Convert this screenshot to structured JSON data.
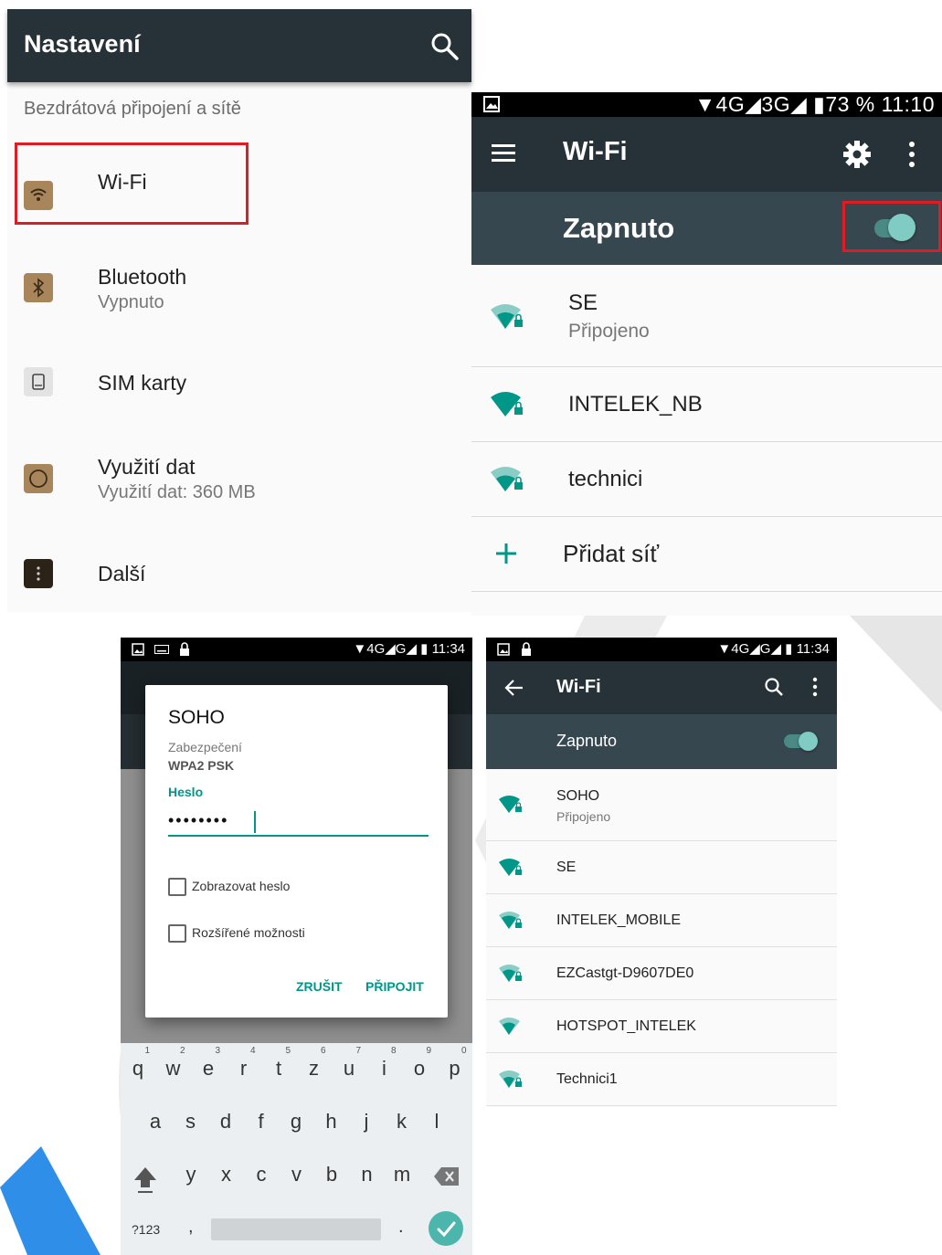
{
  "settings": {
    "title": "Nastavení",
    "section": "Bezdrátová připojení a sítě",
    "items": [
      {
        "label": "Wi-Fi",
        "sub": ""
      },
      {
        "label": "Bluetooth",
        "sub": "Vypnuto"
      },
      {
        "label": "SIM karty",
        "sub": ""
      },
      {
        "label": "Využití dat",
        "sub": "Využití dat: 360 MB"
      },
      {
        "label": "Další",
        "sub": ""
      }
    ]
  },
  "wifi1": {
    "status": "▼4G◢3G◢ ▮73 %  11:10",
    "title": "Wi-Fi",
    "toggle_label": "Zapnuto",
    "toggle_on": true,
    "networks": [
      {
        "name": "SE",
        "state": "Připojeno"
      },
      {
        "name": "INTELEK_NB",
        "state": ""
      },
      {
        "name": "technici",
        "state": ""
      }
    ],
    "add_network": "Přidat síť"
  },
  "dialog": {
    "status": "▼4G◢G◢ ▮ 11:34",
    "title": "SOHO",
    "security_label": "Zabezpečení",
    "security_value": "WPA2 PSK",
    "password_label": "Heslo",
    "password_value": "••••••••",
    "show_password": "Zobrazovat heslo",
    "advanced": "Rozšířené možnosti",
    "cancel": "ZRUŠIT",
    "connect": "PŘIPOJIT",
    "keyboard": {
      "row1": [
        "q",
        "w",
        "e",
        "r",
        "t",
        "z",
        "u",
        "i",
        "o",
        "p"
      ],
      "row1_digits": [
        "1",
        "2",
        "3",
        "4",
        "5",
        "6",
        "7",
        "8",
        "9",
        "0"
      ],
      "row2": [
        "a",
        "s",
        "d",
        "f",
        "g",
        "h",
        "j",
        "k",
        "l"
      ],
      "row3": [
        "y",
        "x",
        "c",
        "v",
        "b",
        "n",
        "m"
      ],
      "symbols": "?123",
      "comma": ",",
      "period": "."
    }
  },
  "wifi2": {
    "status": "▼4G◢G◢ ▮ 11:34",
    "title": "Wi-Fi",
    "toggle_label": "Zapnuto",
    "networks": [
      {
        "name": "SOHO",
        "state": "Připojeno"
      },
      {
        "name": "SE",
        "state": ""
      },
      {
        "name": "INTELEK_MOBILE",
        "state": ""
      },
      {
        "name": "EZCastgt-D9607DE0",
        "state": ""
      },
      {
        "name": "HOTSPOT_INTELEK",
        "state": ""
      },
      {
        "name": "Technici1",
        "state": ""
      }
    ]
  },
  "colors": {
    "appbar": "#263238",
    "togglebar": "#37474f",
    "accent": "#009688",
    "highlight": "#e01b24"
  }
}
